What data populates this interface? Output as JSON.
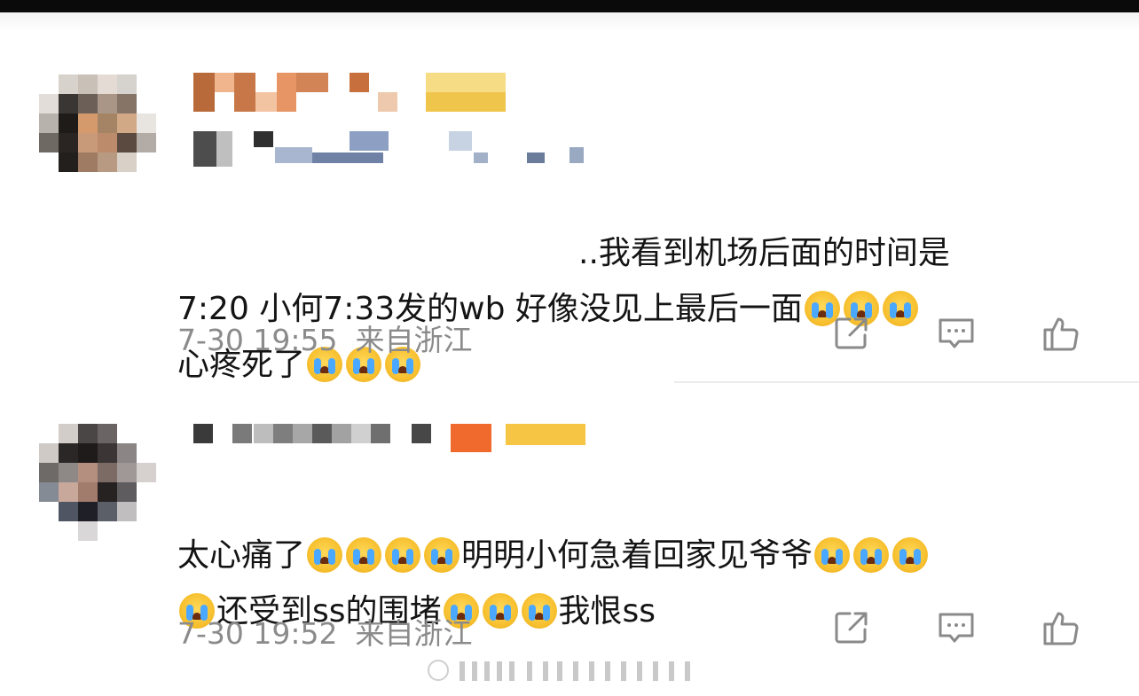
{
  "comments": [
    {
      "text_line1": "..我看到机场后面的时间是",
      "text_line2": "7:20 小何7:33发的wb 好像没见上最后一面",
      "text_line3": "心疼死了",
      "time": "7-30 19:55",
      "location": "来自浙江"
    },
    {
      "text_part1": "太心痛了",
      "text_part2": "明明小何急着回家见爷爷",
      "text_part3": "还受到ss的围堵",
      "text_part4": "我恨ss",
      "time": "7-30 19:52",
      "location": "来自浙江"
    }
  ],
  "icons": {
    "share": "share-icon",
    "comment": "comment-icon",
    "like": "like-icon",
    "emoji": "crying-face-emoji"
  },
  "colors": {
    "text": "#141414",
    "meta": "#8b8b8b",
    "emoji": "#f6be2c"
  }
}
